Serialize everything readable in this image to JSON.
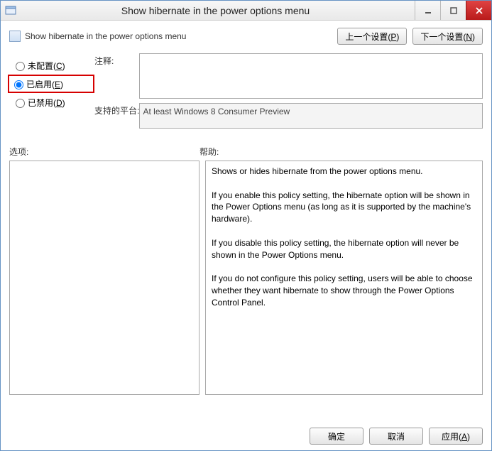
{
  "window": {
    "title": "Show hibernate in the power options menu"
  },
  "header": {
    "policy_title": "Show hibernate in the power options menu",
    "prev_label": "上一个设置(",
    "prev_key": "P",
    "prev_tail": ")",
    "next_label": "下一个设置(",
    "next_key": "N",
    "next_tail": ")"
  },
  "radios": {
    "not_configured": "未配置(",
    "not_configured_key": "C",
    "not_configured_tail": ")",
    "enabled": "已启用(",
    "enabled_key": "E",
    "enabled_tail": ")",
    "disabled": "已禁用(",
    "disabled_key": "D",
    "disabled_tail": ")"
  },
  "fields": {
    "comment_label": "注释:",
    "comment_value": "",
    "supported_label": "支持的平台:",
    "supported_value": "At least Windows 8 Consumer Preview"
  },
  "split": {
    "options_label": "选项:",
    "help_label": "帮助:",
    "options_value": "",
    "help_value": "Shows or hides hibernate from the power options menu.\n\nIf you enable this policy setting, the hibernate option will be shown in the Power Options menu (as long as it is supported by the machine's hardware).\n\nIf you disable this policy setting, the hibernate option will never be shown in the Power Options menu.\n\nIf you do not configure this policy setting, users will be able to choose whether they want hibernate to show through the Power Options Control Panel."
  },
  "footer": {
    "ok": "确定",
    "cancel": "取消",
    "apply": "应用(",
    "apply_key": "A",
    "apply_tail": ")"
  }
}
